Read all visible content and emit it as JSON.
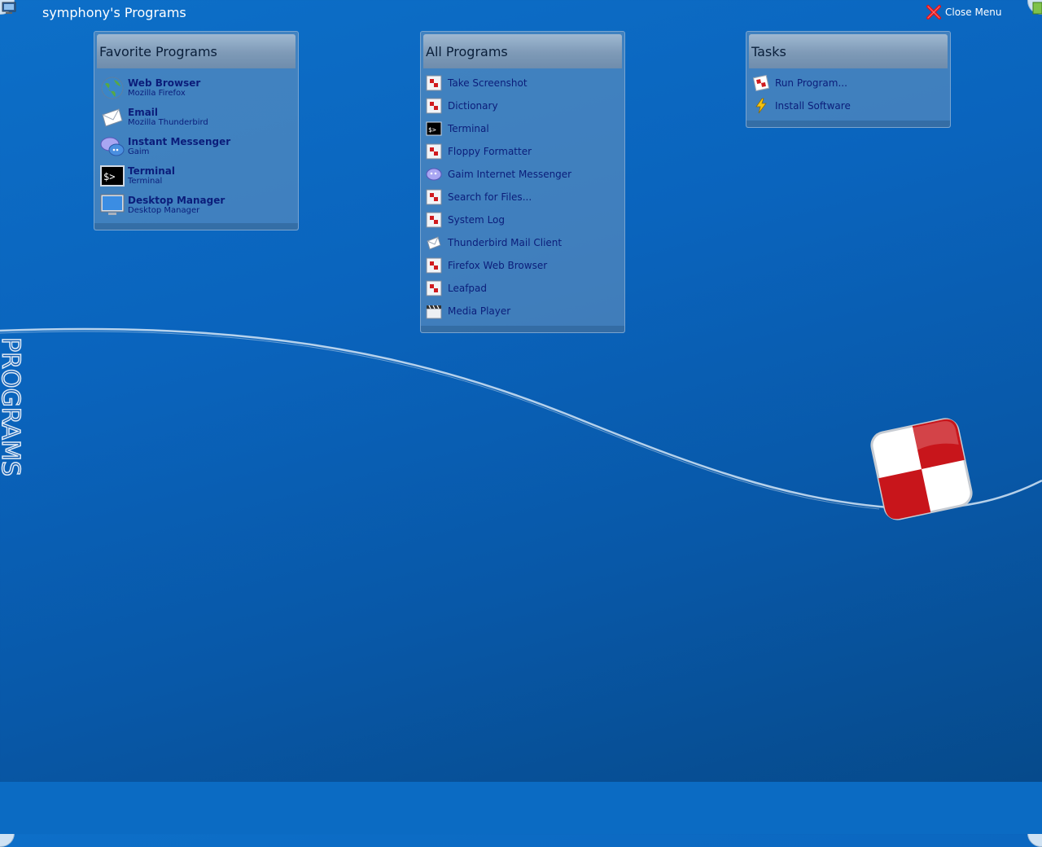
{
  "header": {
    "title": "symphony's Programs",
    "close_label": "Close Menu"
  },
  "side_label": "PROGRAMS",
  "favorites": {
    "title": "Favorite Programs",
    "items": [
      {
        "name": "Web Browser",
        "sub": "Mozilla Firefox",
        "icon": "globe-icon"
      },
      {
        "name": "Email",
        "sub": "Mozilla Thunderbird",
        "icon": "envelope-icon"
      },
      {
        "name": "Instant Messenger",
        "sub": "Gaim",
        "icon": "chat-icon"
      },
      {
        "name": "Terminal",
        "sub": "Terminal",
        "icon": "terminal-icon"
      },
      {
        "name": "Desktop Manager",
        "sub": "Desktop Manager",
        "icon": "monitor-icon"
      }
    ]
  },
  "all_programs": {
    "title": "All Programs",
    "items": [
      {
        "label": "Take Screenshot",
        "icon": "app-icon"
      },
      {
        "label": "Dictionary",
        "icon": "app-icon"
      },
      {
        "label": "Terminal",
        "icon": "terminal-icon"
      },
      {
        "label": "Floppy Formatter",
        "icon": "app-icon"
      },
      {
        "label": "Gaim Internet Messenger",
        "icon": "chat-icon"
      },
      {
        "label": "Search for Files...",
        "icon": "app-icon"
      },
      {
        "label": "System Log",
        "icon": "app-icon"
      },
      {
        "label": "Thunderbird Mail Client",
        "icon": "envelope-icon"
      },
      {
        "label": "Firefox Web Browser",
        "icon": "app-icon"
      },
      {
        "label": "Leafpad",
        "icon": "app-icon"
      },
      {
        "label": "Media Player",
        "icon": "clapperboard-icon"
      }
    ]
  },
  "tasks": {
    "title": "Tasks",
    "items": [
      {
        "label": "Run Program...",
        "icon": "run-icon"
      },
      {
        "label": "Install Software",
        "icon": "lightning-icon"
      }
    ]
  },
  "colors": {
    "accent_red": "#c8151b",
    "link_text": "#0b1d7a"
  }
}
